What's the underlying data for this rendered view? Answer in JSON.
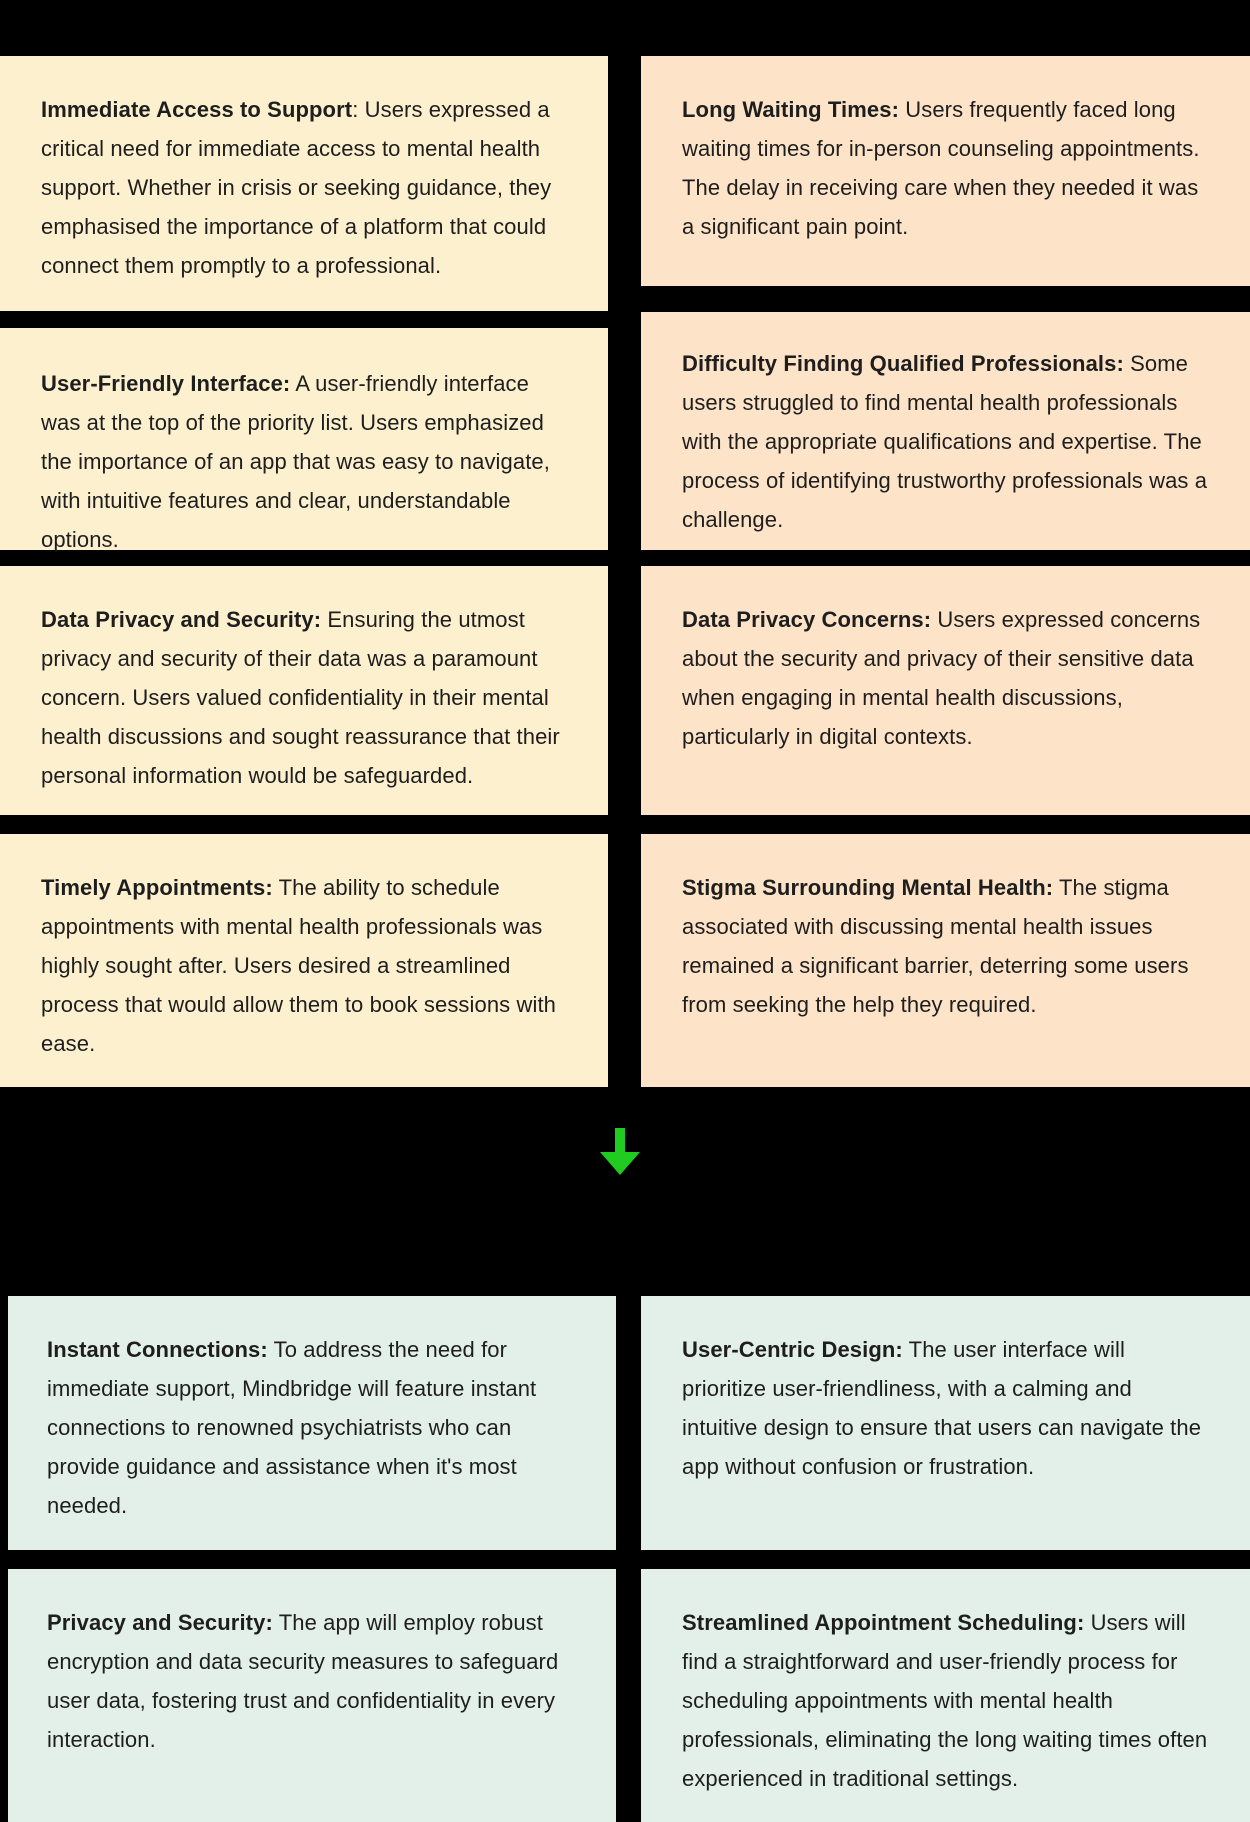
{
  "colors": {
    "needs_card": "#fdf0cf",
    "pain_card": "#fde3c7",
    "solution_card": "#e3f0e9",
    "arrow": "#1fcc1f",
    "background": "#000000"
  },
  "user_needs": [
    {
      "title": "Immediate Access to Support",
      "body": ": Users expressed a critical need for immediate access to mental health support. Whether in crisis or seeking guidance, they emphasised the importance of a platform that could connect them promptly to a professional."
    },
    {
      "title": "User-Friendly Interface:",
      "body": " A user-friendly interface was at the top of the priority list. Users emphasized the importance of an app that was easy to navigate, with intuitive features and clear, understandable options."
    },
    {
      "title": "Data Privacy and Security:",
      "body": " Ensuring the utmost privacy and security of their data was a paramount concern. Users valued confidentiality in their mental health discussions and sought reassurance that their personal information would be safeguarded."
    },
    {
      "title": "Timely Appointments:",
      "body": " The ability to schedule appointments with mental health professionals was highly sought after. Users desired a streamlined process that would allow them to book sessions with ease."
    }
  ],
  "pain_points": [
    {
      "title": "Long Waiting Times:",
      "body": " Users frequently faced long waiting times for in-person counseling appointments. The delay in receiving care when they needed it was a significant pain point."
    },
    {
      "title": "Difficulty Finding Qualified Professionals:",
      "body": " Some users struggled to find mental health professionals with the appropriate qualifications and expertise. The process of identifying trustworthy professionals was a challenge."
    },
    {
      "title": "Data Privacy Concerns:",
      "body": " Users expressed concerns about the security and privacy of their sensitive data when engaging in mental health discussions, particularly in digital contexts."
    },
    {
      "title": "Stigma Surrounding Mental Health:",
      "body": " The stigma associated with discussing mental health issues remained a significant barrier, deterring some users from seeking the help they required."
    }
  ],
  "solutions": [
    {
      "title": "Instant Connections:",
      "body": " To address the need for immediate support, Mindbridge will feature instant connections to renowned psychiatrists who can provide guidance and assistance when it's most needed."
    },
    {
      "title": "User-Centric Design:",
      "body": " The user interface will prioritize user-friendliness, with a calming and intuitive design to ensure that users can navigate the app without confusion or frustration."
    },
    {
      "title": "Privacy and Security:",
      "body": " The app will employ robust encryption and data security measures to safeguard user data, fostering trust and confidentiality in every interaction."
    },
    {
      "title": "Streamlined Appointment Scheduling:",
      "body": " Users will find a straightforward and user-friendly process for scheduling appointments with mental health professionals, eliminating the long waiting times often experienced in traditional settings."
    }
  ],
  "icons": {
    "transition": "arrow-down-icon"
  }
}
